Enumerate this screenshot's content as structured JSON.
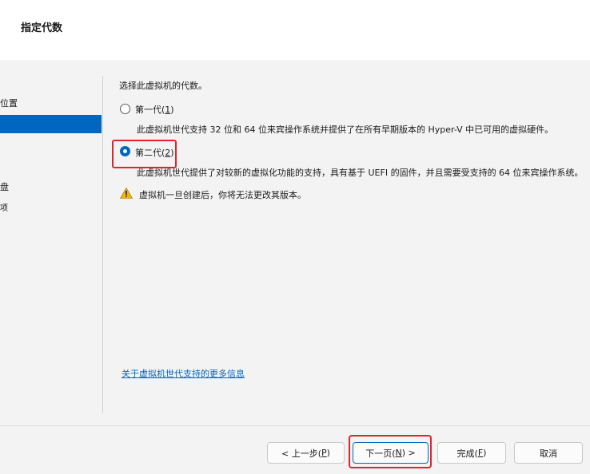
{
  "header": {
    "title": "指定代数"
  },
  "nav": {
    "items": [
      {
        "label": "位置"
      },
      {
        "label": ""
      },
      {
        "label": "盘"
      },
      {
        "label": "项"
      }
    ]
  },
  "content": {
    "intro": "选择此虚拟机的代数。",
    "options": [
      {
        "label": "第一代(1)",
        "label_text": "第一代(",
        "accel": "1",
        "label_end": ")",
        "selected": false,
        "description": "此虚拟机世代支持 32 位和 64 位来宾操作系统并提供了在所有早期版本的 Hyper-V 中已可用的虚拟硬件。"
      },
      {
        "label": "第二代(2)",
        "label_text": "第二代(",
        "accel": "2",
        "label_end": ")",
        "selected": true,
        "description": "此虚拟机世代提供了对较新的虚拟化功能的支持，具有基于 UEFI 的固件，并且需要受支持的 64 位来宾操作系统。"
      }
    ],
    "warning": {
      "icon": "warning-icon",
      "text": "虚拟机一旦创建后，你将无法更改其版本。"
    },
    "more_link": "关于虚拟机世代支持的更多信息"
  },
  "footer": {
    "buttons": [
      {
        "label": "< 上一步(P)",
        "pre": "< 上一步(",
        "accel": "P",
        "post": ")"
      },
      {
        "label": "下一页(N) >",
        "pre": "下一页(",
        "accel": "N",
        "post": ") >"
      },
      {
        "label": "完成(F)",
        "pre": "完成(",
        "accel": "F",
        "post": ")"
      },
      {
        "label": "取消",
        "pre": "取消",
        "accel": "",
        "post": ""
      }
    ]
  },
  "colors": {
    "accent": "#0067c0",
    "highlight": "#e0252a",
    "warning": "#f2b705"
  }
}
